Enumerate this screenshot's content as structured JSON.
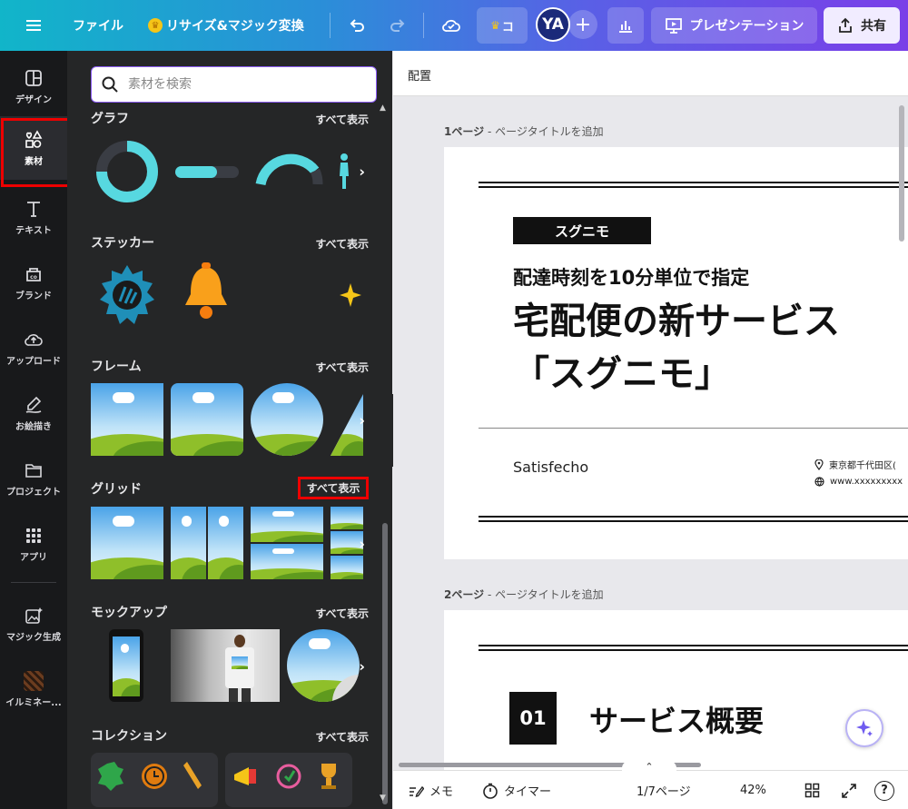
{
  "topbar": {
    "file_label": "ファイル",
    "resize_label": "リサイズ&マジック変換",
    "pro_label": "コ",
    "avatar_initials": "YA",
    "add_user": "+",
    "present_label": "プレゼンテーション",
    "share_label": "共有"
  },
  "rail": {
    "items": [
      {
        "label": "デザイン",
        "icon": "layout-icon"
      },
      {
        "label": "素材",
        "icon": "shapes-icon"
      },
      {
        "label": "テキスト",
        "icon": "text-icon"
      },
      {
        "label": "ブランド",
        "icon": "brand-icon"
      },
      {
        "label": "アップロード",
        "icon": "upload-icon"
      },
      {
        "label": "お絵描き",
        "icon": "draw-icon"
      },
      {
        "label": "プロジェクト",
        "icon": "folder-icon"
      },
      {
        "label": "アプリ",
        "icon": "apps-icon"
      },
      {
        "label": "マジック生成",
        "icon": "magic-image-icon"
      },
      {
        "label": "イルミネー...",
        "icon": "illumination-thumb"
      }
    ]
  },
  "panel": {
    "search_placeholder": "素材を検索",
    "see_all": "すべて表示",
    "sections": [
      {
        "title": "グラフ"
      },
      {
        "title": "ステッカー"
      },
      {
        "title": "フレーム"
      },
      {
        "title": "グリッド"
      },
      {
        "title": "モックアップ"
      },
      {
        "title": "コレクション"
      }
    ]
  },
  "workspace": {
    "header": "配置",
    "page1_label_num": "1ページ",
    "page1_label_hint": " - ページタイトルを追加",
    "page2_label_num": "2ページ",
    "page2_label_hint": " - ページタイトルを追加",
    "slide1": {
      "tag": "スグニモ",
      "sub": "配達時刻を10分単位で指定",
      "headline1": "宅配便の新サービス",
      "headline2": "「スグニモ」",
      "company": "Satisfecho",
      "address": "東京都千代田区(",
      "url": "www.xxxxxxxxx"
    },
    "slide2": {
      "num": "01",
      "title": "サービス概要"
    }
  },
  "footer": {
    "notes": "メモ",
    "timer": "タイマー",
    "pages": "1/7ページ",
    "zoom": "42%",
    "help": "?"
  },
  "colors": {
    "topbar_gradient_start": "#11b5c9",
    "topbar_gradient_end": "#7a3fe8",
    "highlight_red": "#ee0000",
    "panel_bg": "#252627",
    "rail_bg": "#18191b"
  }
}
